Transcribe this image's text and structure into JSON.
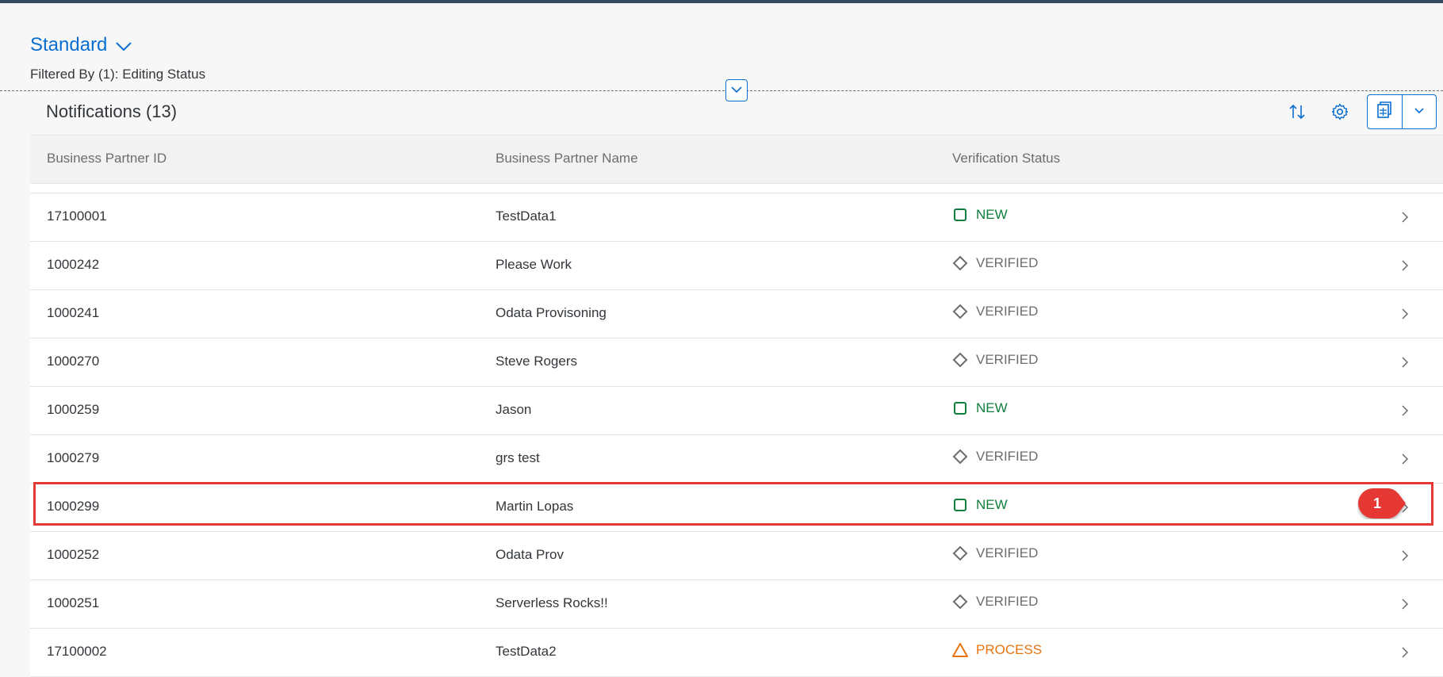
{
  "header": {
    "variant_title": "Standard",
    "filter_text": "Filtered By (1): Editing Status"
  },
  "table": {
    "title": "Notifications (13)",
    "columns": [
      "Business Partner ID",
      "Business Partner Name",
      "Verification Status"
    ],
    "rows": [
      {
        "id": "17100001",
        "name": "TestData1",
        "status": "NEW",
        "status_kind": "new"
      },
      {
        "id": "1000242",
        "name": "Please Work",
        "status": "VERIFIED",
        "status_kind": "verified"
      },
      {
        "id": "1000241",
        "name": "Odata Provisoning",
        "status": "VERIFIED",
        "status_kind": "verified"
      },
      {
        "id": "1000270",
        "name": "Steve Rogers",
        "status": "VERIFIED",
        "status_kind": "verified"
      },
      {
        "id": "1000259",
        "name": "Jason",
        "status": "NEW",
        "status_kind": "new"
      },
      {
        "id": "1000279",
        "name": "grs test",
        "status": "VERIFIED",
        "status_kind": "verified"
      },
      {
        "id": "1000299",
        "name": "Martin Lopas",
        "status": "NEW",
        "status_kind": "new"
      },
      {
        "id": "1000252",
        "name": "Odata Prov",
        "status": "VERIFIED",
        "status_kind": "verified"
      },
      {
        "id": "1000251",
        "name": "Serverless Rocks!!",
        "status": "VERIFIED",
        "status_kind": "verified"
      },
      {
        "id": "17100002",
        "name": "TestData2",
        "status": "PROCESS",
        "status_kind": "process"
      }
    ]
  },
  "annotation": {
    "step_number": "1",
    "highlighted_row_id": "1000299"
  },
  "icons": {
    "variant": "chevron-down-icon",
    "collapse": "chevron-down-icon",
    "sort": "sort-icon",
    "settings": "gear-icon",
    "export": "spreadsheet-export-icon",
    "export_menu": "chevron-down-icon",
    "row_nav": "chevron-right-icon",
    "status_new": "square-outline-icon",
    "status_verified": "diamond-outline-icon",
    "status_process": "triangle-warning-icon"
  },
  "colors": {
    "accent": "#0a6ed1",
    "new": "#107e3e",
    "verified": "#6a6d70",
    "process": "#e9730c",
    "highlight": "#e53935",
    "topbar": "#354a5f"
  }
}
